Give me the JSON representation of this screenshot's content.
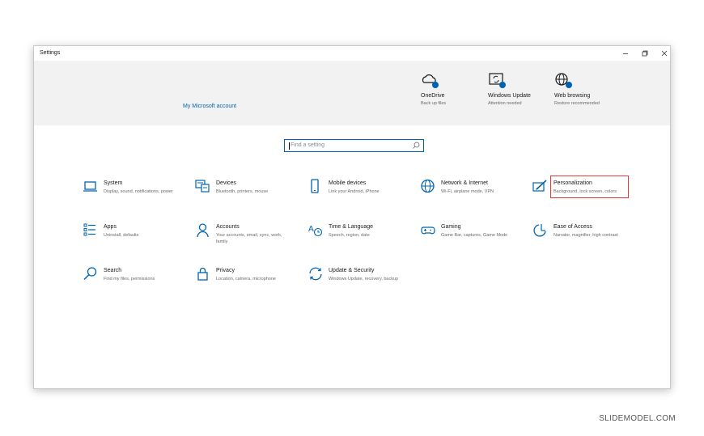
{
  "window": {
    "title": "Settings"
  },
  "header": {
    "account_link": "My Microsoft account",
    "quick": [
      {
        "title": "OneDrive",
        "sub": "Back up files",
        "icon": "cloud-icon"
      },
      {
        "title": "Windows Update",
        "sub": "Attention needed",
        "icon": "refresh-icon"
      },
      {
        "title": "Web browsing",
        "sub": "Restore recommended",
        "icon": "globe-icon"
      }
    ]
  },
  "search": {
    "placeholder": "Find a setting"
  },
  "categories": [
    {
      "title": "System",
      "sub": "Display, sound, notifications, power",
      "icon": "laptop-icon"
    },
    {
      "title": "Devices",
      "sub": "Bluetooth, printers, mouse",
      "icon": "keyboard-icon"
    },
    {
      "title": "Mobile devices",
      "sub": "Link your Android, iPhone",
      "icon": "phone-icon"
    },
    {
      "title": "Network & Internet",
      "sub": "Wi-Fi, airplane mode, VPN",
      "icon": "globe-icon"
    },
    {
      "title": "Personalization",
      "sub": "Background, lock screen, colors",
      "icon": "paint-icon"
    },
    {
      "title": "Apps",
      "sub": "Uninstall, defaults",
      "icon": "apps-list-icon"
    },
    {
      "title": "Accounts",
      "sub": "Your accounts, email, sync, work, family",
      "icon": "person-icon"
    },
    {
      "title": "Time & Language",
      "sub": "Speech, region, date",
      "icon": "time-language-icon"
    },
    {
      "title": "Gaming",
      "sub": "Game Bar, captures, Game Mode",
      "icon": "gamepad-icon"
    },
    {
      "title": "Ease of Access",
      "sub": "Narrator, magnifier, high contrast",
      "icon": "ease-access-icon"
    },
    {
      "title": "Search",
      "sub": "Find my files, permissions",
      "icon": "search-icon"
    },
    {
      "title": "Privacy",
      "sub": "Location, camera, microphone",
      "icon": "lock-icon"
    },
    {
      "title": "Update & Security",
      "sub": "Windows Update, recovery, backup",
      "icon": "sync-icon"
    }
  ],
  "colors": {
    "accent": "#0063b1",
    "highlight": "#e53935",
    "header_bg": "#f2f2f2"
  },
  "watermark": "SLIDEMODEL.COM"
}
